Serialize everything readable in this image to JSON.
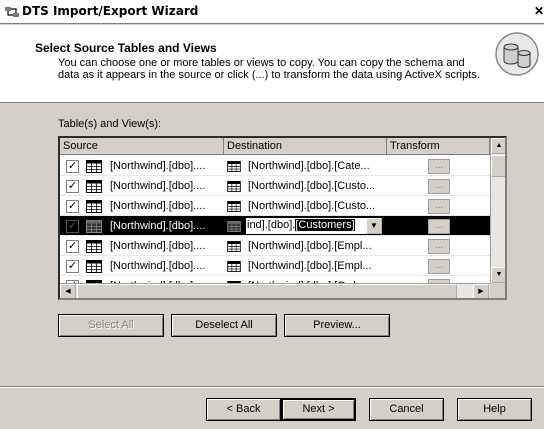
{
  "window": {
    "title": "DTS Import/Export Wizard",
    "close_glyph": "✕"
  },
  "header": {
    "title": "Select Source Tables and Views",
    "description": "You can choose one or more tables or views to copy.  You can copy the schema and data as it appears in the source or click (...) to transform the data using ActiveX scripts."
  },
  "grid": {
    "label": "Table(s) and View(s):",
    "columns": [
      "Source",
      "Destination",
      "Transform"
    ],
    "rows": [
      {
        "checked": true,
        "source": "[Northwind].[dbo]....",
        "destination": "[Northwind].[dbo].[Cate...",
        "transform": "...",
        "selected": false
      },
      {
        "checked": true,
        "source": "[Northwind].[dbo]....",
        "destination": "[Northwind].[dbo].[Custo...",
        "transform": "...",
        "selected": false
      },
      {
        "checked": true,
        "source": "[Northwind].[dbo]....",
        "destination": "[Northwind].[dbo].[Custo...",
        "transform": "...",
        "selected": false
      },
      {
        "checked": true,
        "source": "[Northwind].[dbo]....",
        "destination_prefix": "ind].[dbo].",
        "destination_selected": "[Customers]",
        "transform": "...",
        "selected": true
      },
      {
        "checked": true,
        "source": "[Northwind].[dbo]....",
        "destination": "[Northwind].[dbo].[Empl...",
        "transform": "...",
        "selected": false
      },
      {
        "checked": true,
        "source": "[Northwind].[dbo]....",
        "destination": "[Northwind].[dbo].[Empl...",
        "transform": "...",
        "selected": false
      },
      {
        "checked": true,
        "source": "[Northwind].[dbo]....",
        "destination": "[Northwind].[dbo].[Orde...",
        "transform": "...",
        "selected": false
      }
    ]
  },
  "actions": {
    "select_all": "Select All",
    "deselect_all": "Deselect All",
    "preview": "Preview..."
  },
  "footer": {
    "back": "< Back",
    "next": "Next >",
    "cancel": "Cancel",
    "help": "Help"
  },
  "icons": {
    "title": "wizard-app-icon",
    "header": "database-cylinders-icon",
    "row_source": "table-icon",
    "row_destination": "table-icon"
  }
}
